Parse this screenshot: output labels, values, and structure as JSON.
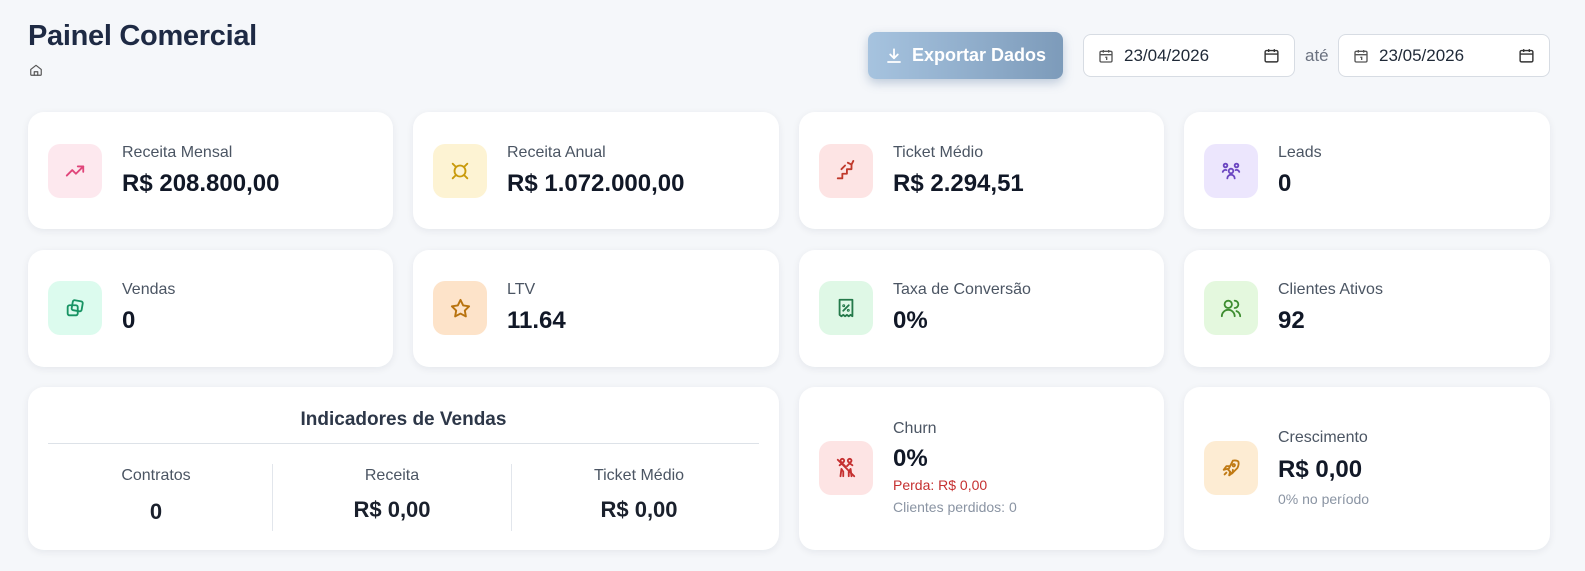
{
  "header": {
    "title": "Painel Comercial",
    "home_icon": "home-icon",
    "export_label": "Exportar Dados",
    "date_from": "23/04/2026",
    "date_separator": "até",
    "date_to": "23/05/2026"
  },
  "kpis": [
    {
      "label": "Receita Mensal",
      "value": "R$ 208.800,00",
      "icon": "trending-up-icon",
      "color": "#e0457a",
      "bg": "#fde8ee"
    },
    {
      "label": "Receita Anual",
      "value": "R$ 1.072.000,00",
      "icon": "currency-icon",
      "color": "#c99a0b",
      "bg": "#fdf3d3"
    },
    {
      "label": "Ticket Médio",
      "value": "R$ 2.294,51",
      "icon": "stairs-up-icon",
      "color": "#c0392b",
      "bg": "#fde4e4"
    },
    {
      "label": "Leads",
      "value": "0",
      "icon": "users-group-icon",
      "color": "#6b46c1",
      "bg": "#ece6fd"
    },
    {
      "label": "Vendas",
      "value": "0",
      "icon": "squares-icon",
      "color": "#179363",
      "bg": "#dcfbee"
    },
    {
      "label": "LTV",
      "value": "11.64",
      "icon": "star-icon",
      "color": "#b8730f",
      "bg": "#fde3c9"
    },
    {
      "label": "Taxa de Conversão",
      "value": "0%",
      "icon": "receipt-percent-icon",
      "color": "#24794a",
      "bg": "#dff8e6"
    },
    {
      "label": "Clientes Ativos",
      "value": "92",
      "icon": "users-icon",
      "color": "#3e8d30",
      "bg": "#e4f8de"
    }
  ],
  "indicators": {
    "title": "Indicadores de Vendas",
    "items": [
      {
        "label": "Contratos",
        "value": "0"
      },
      {
        "label": "Receita",
        "value": "R$ 0,00"
      },
      {
        "label": "Ticket Médio",
        "value": "R$ 0,00"
      }
    ]
  },
  "churn": {
    "label": "Churn",
    "value": "0%",
    "loss": "Perda: R$ 0,00",
    "lost_clients": "Clientes perdidos: 0",
    "icon": "people-leaving-icon",
    "color": "#c53030",
    "bg": "#fde4e4"
  },
  "growth": {
    "label": "Crescimento",
    "value": "R$ 0,00",
    "period": "0% no período",
    "icon": "rocket-icon",
    "color": "#c07a14",
    "bg": "#fdecd3"
  }
}
